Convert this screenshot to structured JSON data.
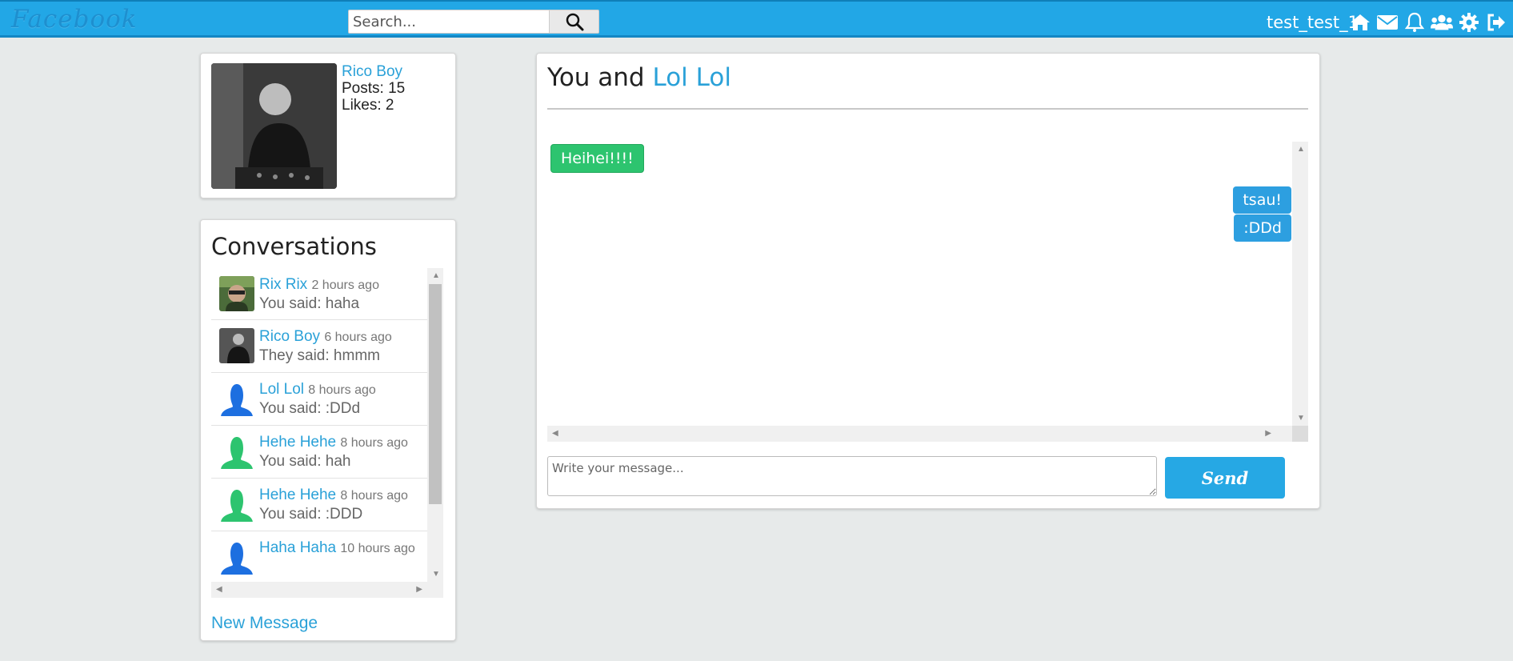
{
  "app": {
    "brand": "Facebook"
  },
  "search": {
    "placeholder": "Search..."
  },
  "user": {
    "username": "test_test_1"
  },
  "nav": {
    "icons": [
      "home-icon",
      "envelope-icon",
      "bell-icon",
      "users-icon",
      "gear-icon",
      "sign-out-icon"
    ]
  },
  "profile": {
    "name": "Rico Boy",
    "posts": "Posts: 15",
    "likes": "Likes: 2"
  },
  "conversations": {
    "title": "Conversations",
    "items": [
      {
        "name": "Rix Rix",
        "time": "2 hours ago",
        "last": "You said: haha",
        "avatar": "photo-green"
      },
      {
        "name": "Rico Boy",
        "time": "6 hours ago",
        "last": "They said: hmmm",
        "avatar": "photo-bw"
      },
      {
        "name": "Lol Lol",
        "time": "8 hours ago",
        "last": "You said: :DDd",
        "avatar": "silhouette-blue"
      },
      {
        "name": "Hehe Hehe",
        "time": "8 hours ago",
        "last": "You said: hah",
        "avatar": "silhouette-green"
      },
      {
        "name": "Hehe Hehe",
        "time": "8 hours ago",
        "last": "You said: :DDD",
        "avatar": "silhouette-green"
      },
      {
        "name": "Haha Haha",
        "time": "10 hours ago",
        "last": "",
        "avatar": "silhouette-blue"
      }
    ],
    "new_message": "New Message"
  },
  "chat": {
    "title_prefix": "You and",
    "partner": "Lol Lol",
    "messages": [
      {
        "text": "Heihei!!!!",
        "direction": "in"
      },
      {
        "text": "tsau!",
        "direction": "out"
      },
      {
        "text": ":DDd",
        "direction": "out"
      }
    ],
    "input_placeholder": "Write your message...",
    "send_label": "Send"
  },
  "colors": {
    "accent": "#22a7e6",
    "incoming": "#2dc46f",
    "outgoing": "#2d9fe0",
    "link": "#2aa1d8"
  }
}
